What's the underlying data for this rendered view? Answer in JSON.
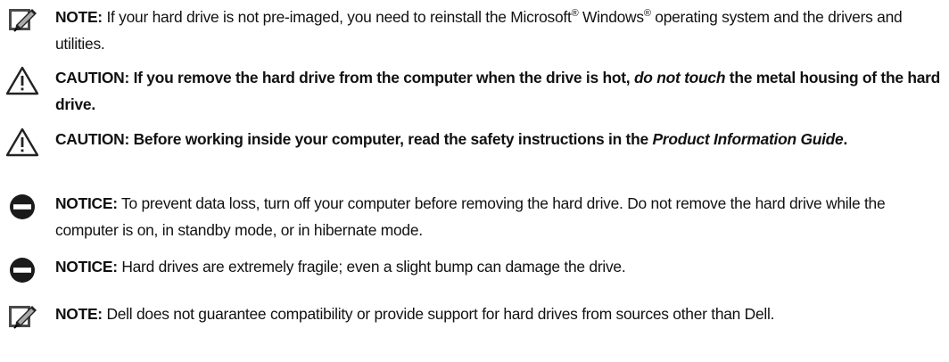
{
  "notes": [
    {
      "type": "note",
      "icon": "pencil-note-icon",
      "label": "NOTE:",
      "text_a": " If your hard drive is not pre-imaged, you need to reinstall the Microsoft",
      "sup1": "®",
      "text_b": " Windows",
      "sup2": "®",
      "text_c": " operating system and the drivers and utilities."
    },
    {
      "type": "caution",
      "icon": "warning-triangle-icon",
      "label": "CAUTION:",
      "text_a": " If you remove the hard drive from the computer when the drive is hot, ",
      "italic": "do not touch",
      "text_b": " the metal housing of the hard drive."
    },
    {
      "type": "caution",
      "icon": "warning-triangle-icon",
      "label": "CAUTION:",
      "text_a": " Before working inside your computer, read the safety instructions in the ",
      "italic": "Product Information Guide",
      "text_b": "."
    },
    {
      "type": "notice",
      "icon": "notice-circle-icon",
      "label": "NOTICE:",
      "text": " To prevent data loss, turn off your computer before removing the hard drive. Do not remove the hard drive while the computer is on, in standby mode, or in hibernate mode."
    },
    {
      "type": "notice",
      "icon": "notice-circle-icon",
      "label": "NOTICE:",
      "text": " Hard drives are extremely fragile; even a slight bump can damage the drive."
    },
    {
      "type": "note",
      "icon": "pencil-note-icon",
      "label": "NOTE:",
      "text": " Dell does not guarantee compatibility or provide support for hard drives from sources other than Dell."
    }
  ]
}
